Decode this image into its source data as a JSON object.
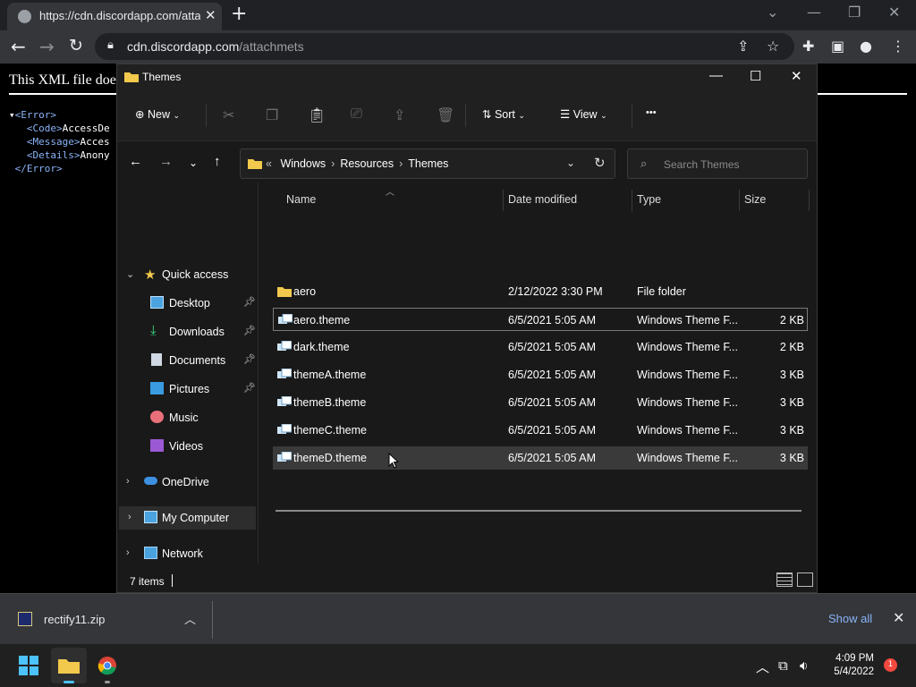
{
  "browser": {
    "tab_title": "https://cdn.discordapp.com/attac",
    "url_host": "cdn.discordapp.com",
    "url_path": "/attachmets"
  },
  "xml_page": {
    "header_text": "This XML file doe",
    "lines": [
      {
        "tag": "<Error>",
        "text": ""
      },
      {
        "tag": "<Code>",
        "text": "AccessDe"
      },
      {
        "tag": "<Message>",
        "text": "Acces"
      },
      {
        "tag": "<Details>",
        "text": "Anony"
      },
      {
        "tag": "</Error>",
        "text": ""
      }
    ]
  },
  "explorer": {
    "window_title": "Themes",
    "commands": {
      "new": "New",
      "sort": "Sort",
      "view": "View",
      "more": "•••"
    },
    "address": {
      "overflow": "«",
      "crumbs": [
        "Windows",
        "Resources",
        "Themes"
      ]
    },
    "search_placeholder": "Search Themes",
    "sidebar": {
      "quick_access": "Quick access",
      "items": [
        {
          "label": "Desktop",
          "icon": "desktop-icon",
          "pinned": true
        },
        {
          "label": "Downloads",
          "icon": "downloads-icon",
          "pinned": true
        },
        {
          "label": "Documents",
          "icon": "documents-icon",
          "pinned": true
        },
        {
          "label": "Pictures",
          "icon": "pictures-icon",
          "pinned": true
        },
        {
          "label": "Music",
          "icon": "music-icon",
          "pinned": false
        },
        {
          "label": "Videos",
          "icon": "videos-icon",
          "pinned": false
        }
      ],
      "onedrive": "OneDrive",
      "my_computer": "My Computer",
      "network": "Network"
    },
    "columns": {
      "name": "Name",
      "date": "Date modified",
      "type": "Type",
      "size": "Size"
    },
    "files": [
      {
        "name": "aero",
        "date": "2/12/2022 3:30 PM",
        "type": "File folder",
        "size": "",
        "kind": "folder"
      },
      {
        "name": "aero.theme",
        "date": "6/5/2021 5:05 AM",
        "type": "Windows Theme F...",
        "size": "2 KB",
        "kind": "theme"
      },
      {
        "name": "dark.theme",
        "date": "6/5/2021 5:05 AM",
        "type": "Windows Theme F...",
        "size": "2 KB",
        "kind": "theme"
      },
      {
        "name": "themeA.theme",
        "date": "6/5/2021 5:05 AM",
        "type": "Windows Theme F...",
        "size": "3 KB",
        "kind": "theme"
      },
      {
        "name": "themeB.theme",
        "date": "6/5/2021 5:05 AM",
        "type": "Windows Theme F...",
        "size": "3 KB",
        "kind": "theme"
      },
      {
        "name": "themeC.theme",
        "date": "6/5/2021 5:05 AM",
        "type": "Windows Theme F...",
        "size": "3 KB",
        "kind": "theme"
      },
      {
        "name": "themeD.theme",
        "date": "6/5/2021 5:05 AM",
        "type": "Windows Theme F...",
        "size": "3 KB",
        "kind": "theme"
      }
    ],
    "status_count": "7 items"
  },
  "download_bar": {
    "file_name": "rectify11.zip",
    "show_all": "Show all"
  },
  "taskbar": {
    "time": "4:09 PM",
    "date": "5/4/2022",
    "notification_count": "1"
  },
  "colors": {
    "accent_folder": "#f2c94c",
    "link_blue": "#8ab4f8",
    "notification_red": "#f2483f"
  }
}
